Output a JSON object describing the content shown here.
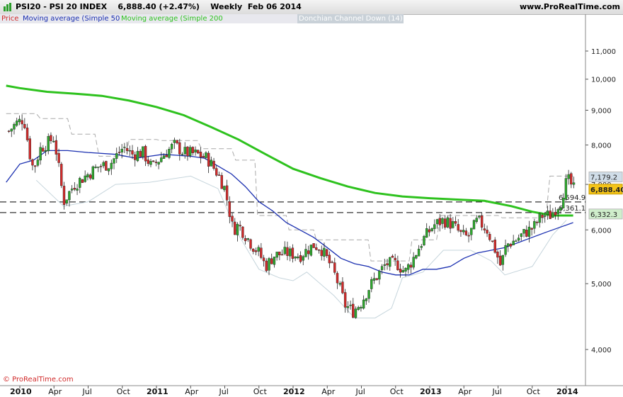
{
  "header": {
    "title": "PSI20 - PSI 20 INDEX    6,888.40 (+2.47%)    Weekly  Feb 06 2014",
    "site": "www.ProRealTime.com"
  },
  "legend": [
    {
      "label": "Price",
      "color": "#d12b2b"
    },
    {
      "label": "Moving average (Simple 50)",
      "color": "#1a2fb0"
    },
    {
      "label": "Moving average (Simple 200)",
      "color": "#2ec21e"
    },
    {
      "label": "",
      "color": "#aaaaaa"
    },
    {
      "label": "Donchian Channel Down (14)",
      "color": "#ffffff"
    }
  ],
  "copyright": "© ProRealTime.com",
  "chart_data": {
    "type": "candlestick",
    "title": "PSI20 - PSI 20 INDEX",
    "timeframe": "Weekly",
    "last_close": "6,888.40",
    "change_pct": "+2.47%",
    "date": "Feb 06 2014",
    "ylim": [
      3500,
      11900
    ],
    "y_ticks": [
      4000,
      5000,
      6000,
      7000,
      8000,
      9000,
      10000,
      11000
    ],
    "y_tick_labels": [
      "4,000",
      "5,000",
      "6,000",
      "7,000",
      "8,000",
      "9,000",
      "10,000",
      "11,000"
    ],
    "x_ticks": [
      2010.0,
      2010.25,
      2010.5,
      2010.75,
      2011.0,
      2011.25,
      2011.5,
      2011.75,
      2012.0,
      2012.25,
      2012.5,
      2012.75,
      2013.0,
      2013.25,
      2013.5,
      2013.75,
      2014.0
    ],
    "x_tick_labels": [
      "2010",
      "Apr",
      "Jul",
      "Oct",
      "2011",
      "Apr",
      "Jul",
      "Oct",
      "2012",
      "Apr",
      "Jul",
      "Oct",
      "2013",
      "Apr",
      "Jul",
      "Oct",
      "2014"
    ],
    "xlim": [
      2009.9,
      2014.1
    ],
    "price_anchors": [
      [
        2009.9,
        8300
      ],
      [
        2009.97,
        8600
      ],
      [
        2010.03,
        8750
      ],
      [
        2010.07,
        7800
      ],
      [
        2010.1,
        7350
      ],
      [
        2010.15,
        7900
      ],
      [
        2010.25,
        8200
      ],
      [
        2010.32,
        6600
      ],
      [
        2010.4,
        7000
      ],
      [
        2010.5,
        7250
      ],
      [
        2010.58,
        7450
      ],
      [
        2010.66,
        7500
      ],
      [
        2010.76,
        7950
      ],
      [
        2010.82,
        7750
      ],
      [
        2010.9,
        7800
      ],
      [
        2010.97,
        7400
      ],
      [
        2011.0,
        7550
      ],
      [
        2011.07,
        7800
      ],
      [
        2011.13,
        8000
      ],
      [
        2011.2,
        7800
      ],
      [
        2011.3,
        7750
      ],
      [
        2011.37,
        7650
      ],
      [
        2011.45,
        7250
      ],
      [
        2011.5,
        6900
      ],
      [
        2011.56,
        6000
      ],
      [
        2011.6,
        6100
      ],
      [
        2011.65,
        5900
      ],
      [
        2011.7,
        5700
      ],
      [
        2011.75,
        5550
      ],
      [
        2011.8,
        5300
      ],
      [
        2011.86,
        5500
      ],
      [
        2011.95,
        5550
      ],
      [
        2012.05,
        5500
      ],
      [
        2012.15,
        5700
      ],
      [
        2012.2,
        5650
      ],
      [
        2012.28,
        5300
      ],
      [
        2012.33,
        5000
      ],
      [
        2012.38,
        4650
      ],
      [
        2012.44,
        4550
      ],
      [
        2012.5,
        4700
      ],
      [
        2012.56,
        4950
      ],
      [
        2012.62,
        5150
      ],
      [
        2012.68,
        5350
      ],
      [
        2012.76,
        5350
      ],
      [
        2012.82,
        5200
      ],
      [
        2012.88,
        5450
      ],
      [
        2012.95,
        5800
      ],
      [
        2013.03,
        6100
      ],
      [
        2013.1,
        6200
      ],
      [
        2013.17,
        6100
      ],
      [
        2013.23,
        5900
      ],
      [
        2013.28,
        5850
      ],
      [
        2013.35,
        6200
      ],
      [
        2013.42,
        6000
      ],
      [
        2013.48,
        5600
      ],
      [
        2013.52,
        5300
      ],
      [
        2013.56,
        5700
      ],
      [
        2013.63,
        5800
      ],
      [
        2013.7,
        5950
      ],
      [
        2013.76,
        6050
      ],
      [
        2013.82,
        6300
      ],
      [
        2013.88,
        6300
      ],
      [
        2013.92,
        6450
      ],
      [
        2013.96,
        6600
      ],
      [
        2013.99,
        7000
      ],
      [
        2014.02,
        7100
      ],
      [
        2014.05,
        6888
      ]
    ],
    "series": [
      {
        "name": "Moving average (Simple 50)",
        "color": "#1a2fb0",
        "points": [
          [
            2009.9,
            7050
          ],
          [
            2010.0,
            7500
          ],
          [
            2010.1,
            7600
          ],
          [
            2010.2,
            7850
          ],
          [
            2010.35,
            7850
          ],
          [
            2010.5,
            7800
          ],
          [
            2010.7,
            7750
          ],
          [
            2010.85,
            7650
          ],
          [
            2010.95,
            7700
          ],
          [
            2011.05,
            7750
          ],
          [
            2011.25,
            7700
          ],
          [
            2011.35,
            7650
          ],
          [
            2011.45,
            7450
          ],
          [
            2011.55,
            7250
          ],
          [
            2011.65,
            6950
          ],
          [
            2011.75,
            6600
          ],
          [
            2011.85,
            6400
          ],
          [
            2011.95,
            6150
          ],
          [
            2012.05,
            6000
          ],
          [
            2012.15,
            5850
          ],
          [
            2012.25,
            5650
          ],
          [
            2012.35,
            5450
          ],
          [
            2012.45,
            5350
          ],
          [
            2012.55,
            5300
          ],
          [
            2012.65,
            5200
          ],
          [
            2012.75,
            5150
          ],
          [
            2012.85,
            5150
          ],
          [
            2012.95,
            5250
          ],
          [
            2013.05,
            5250
          ],
          [
            2013.15,
            5300
          ],
          [
            2013.25,
            5450
          ],
          [
            2013.35,
            5550
          ],
          [
            2013.45,
            5600
          ],
          [
            2013.55,
            5650
          ],
          [
            2013.65,
            5750
          ],
          [
            2013.75,
            5850
          ],
          [
            2013.85,
            5950
          ],
          [
            2013.95,
            6050
          ],
          [
            2014.05,
            6150
          ]
        ]
      },
      {
        "name": "Moving average (Simple 200)",
        "color": "#2ec21e",
        "points": [
          [
            2009.9,
            9780
          ],
          [
            2010.0,
            9700
          ],
          [
            2010.2,
            9580
          ],
          [
            2010.4,
            9520
          ],
          [
            2010.6,
            9450
          ],
          [
            2010.8,
            9300
          ],
          [
            2011.0,
            9100
          ],
          [
            2011.2,
            8850
          ],
          [
            2011.4,
            8500
          ],
          [
            2011.6,
            8150
          ],
          [
            2011.8,
            7750
          ],
          [
            2012.0,
            7380
          ],
          [
            2012.2,
            7150
          ],
          [
            2012.4,
            6950
          ],
          [
            2012.6,
            6800
          ],
          [
            2012.8,
            6720
          ],
          [
            2013.0,
            6680
          ],
          [
            2013.2,
            6650
          ],
          [
            2013.4,
            6620
          ],
          [
            2013.6,
            6500
          ],
          [
            2013.75,
            6380
          ],
          [
            2013.9,
            6300
          ],
          [
            2014.05,
            6300
          ]
        ]
      },
      {
        "name": "",
        "color": "#aaaaaa",
        "dash": true,
        "points": [
          [
            2009.9,
            8900
          ],
          [
            2010.12,
            8900
          ],
          [
            2010.15,
            8750
          ],
          [
            2010.35,
            8750
          ],
          [
            2010.38,
            8300
          ],
          [
            2010.55,
            8300
          ],
          [
            2010.58,
            7700
          ],
          [
            2010.78,
            7700
          ],
          [
            2010.8,
            8150
          ],
          [
            2011.0,
            8150
          ],
          [
            2011.03,
            8120
          ],
          [
            2011.3,
            8120
          ],
          [
            2011.33,
            7900
          ],
          [
            2011.55,
            7900
          ],
          [
            2011.58,
            7600
          ],
          [
            2011.72,
            7600
          ],
          [
            2011.74,
            6300
          ],
          [
            2011.95,
            6300
          ],
          [
            2011.97,
            6000
          ],
          [
            2012.15,
            6000
          ],
          [
            2012.17,
            5800
          ],
          [
            2012.55,
            5800
          ],
          [
            2012.57,
            5400
          ],
          [
            2012.85,
            5400
          ],
          [
            2012.87,
            5800
          ],
          [
            2013.05,
            5800
          ],
          [
            2013.08,
            6300
          ],
          [
            2013.5,
            6300
          ],
          [
            2013.53,
            6250
          ],
          [
            2013.85,
            6250
          ],
          [
            2013.88,
            7200
          ],
          [
            2014.05,
            7200
          ]
        ]
      },
      {
        "name": "Donchian Channel Down (14)",
        "color": "#c6d5dc",
        "points": [
          [
            2010.12,
            7100
          ],
          [
            2010.32,
            6500
          ],
          [
            2010.5,
            6600
          ],
          [
            2010.7,
            7000
          ],
          [
            2010.95,
            7050
          ],
          [
            2011.25,
            7200
          ],
          [
            2011.45,
            6900
          ],
          [
            2011.6,
            5900
          ],
          [
            2011.75,
            5250
          ],
          [
            2011.9,
            5100
          ],
          [
            2012.0,
            5050
          ],
          [
            2012.1,
            5200
          ],
          [
            2012.3,
            4800
          ],
          [
            2012.45,
            4450
          ],
          [
            2012.6,
            4450
          ],
          [
            2012.72,
            4600
          ],
          [
            2012.8,
            5100
          ],
          [
            2012.95,
            5200
          ],
          [
            2013.1,
            5600
          ],
          [
            2013.3,
            5600
          ],
          [
            2013.45,
            5400
          ],
          [
            2013.55,
            5150
          ],
          [
            2013.75,
            5300
          ],
          [
            2013.9,
            5900
          ],
          [
            2014.0,
            6200
          ]
        ]
      }
    ],
    "hlines": [
      {
        "value": 6594.9,
        "label": "6,594.9"
      },
      {
        "value": 6361.1,
        "label": "6,361.1"
      }
    ],
    "price_labels": [
      {
        "value": 7179.2,
        "label": "7,179.2",
        "color": "#d0dde8"
      },
      {
        "value": 6888.4,
        "label": "6,888.40",
        "color": "#f5c518"
      },
      {
        "value": 6332.3,
        "label": "6,332.3",
        "color": "#cfeecb"
      }
    ],
    "grid": false,
    "legend_position": "top-left"
  }
}
